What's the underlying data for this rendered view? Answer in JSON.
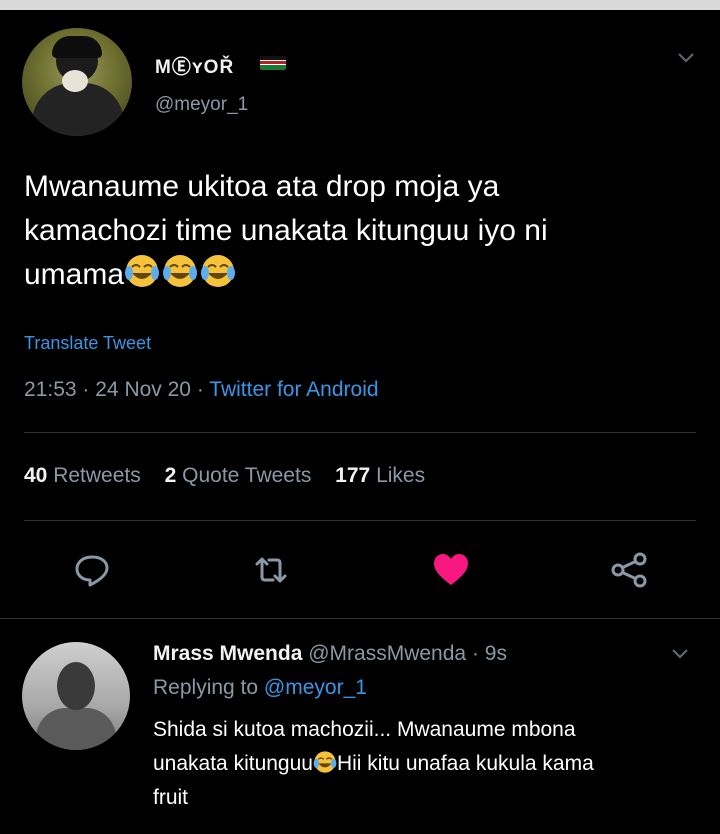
{
  "tweet": {
    "display_name": "MⒺʏOŘ",
    "handle": "@meyor_1",
    "text_line1": "Mwanaume ukitoa ata drop moja ya",
    "text_line2": "kamachozi time unakata kitunguu iyo ni",
    "text_line3": "umama",
    "emoji_icon": "face-with-tears-of-joy",
    "translate_label": "Translate Tweet",
    "time": "21:53",
    "sep1": "·",
    "date": "24 Nov 20",
    "sep2": "·",
    "source": "Twitter for Android",
    "retweets_count": "40",
    "retweets_label": "Retweets",
    "quotes_count": "2",
    "quotes_label": "Quote Tweets",
    "likes_count": "177",
    "likes_label": "Likes",
    "liked": true,
    "like_color": "#f91880",
    "link_color": "#3a96e4"
  },
  "reply": {
    "name": "Mrass Mwenda",
    "handle": "@MrassMwenda",
    "sep": "·",
    "age": "9s",
    "replying_prefix": "Replying to",
    "replying_to": "@meyor_1",
    "text_line1": "Shida si kutoa machozii... Mwanaume mbona",
    "text_line2a": "unakata kitunguu",
    "text_line2b": "Hii kitu unafaa kukula kama",
    "text_line3": "fruit"
  },
  "icons": [
    "reply-icon",
    "retweet-icon",
    "like-icon",
    "share-icon",
    "chevron-down-icon",
    "kenya-flag-icon"
  ]
}
